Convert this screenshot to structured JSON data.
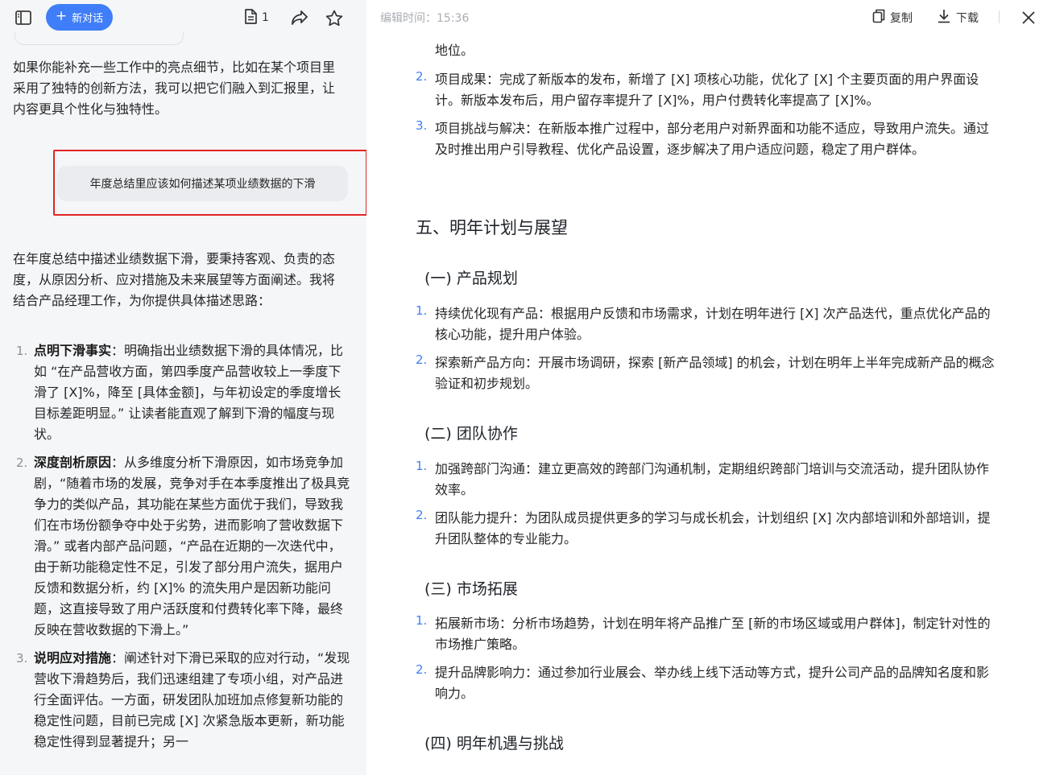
{
  "left_toolbar": {
    "sidebar_icon": "sidebar-toggle-icon",
    "new_chat_label": "新对话",
    "doc_count": "1",
    "share_icon": "share-icon",
    "star_icon": "star-icon"
  },
  "chat": {
    "prev_ai_text": "如果你能补充一些工作中的亮点细节，比如在某个项目里采用了独特的创新方法，我可以把它们融入到汇报里，让内容更具个性化与独特性。",
    "user_question": "年度总结里应该如何描述某项业绩数据的下滑",
    "answer_intro": "在年度总结中描述业绩数据下滑，要秉持客观、负责的态度，从原因分析、应对措施及未来展望等方面阐述。我将结合产品经理工作，为你提供具体描述思路：",
    "answer_items": [
      {
        "num": "1.",
        "title": "点明下滑事实",
        "text": "：明确指出业绩数据下滑的具体情况，比如 “在产品营收方面，第四季度产品营收较上一季度下滑了 [X]%，降至 [具体金额]，与年初设定的季度增长目标差距明显。” 让读者能直观了解到下滑的幅度与现状。"
      },
      {
        "num": "2.",
        "title": "深度剖析原因",
        "text": "：从多维度分析下滑原因，如市场竞争加剧，“随着市场的发展，竞争对手在本季度推出了极具竞争力的类似产品，其功能在某些方面优于我们，导致我们在市场份额争夺中处于劣势，进而影响了营收数据下滑。” 或者内部产品问题，“产品在近期的一次迭代中，由于新功能稳定性不足，引发了部分用户流失，据用户反馈和数据分析，约 [X]% 的流失用户是因新功能问题，这直接导致了用户活跃度和付费转化率下降，最终反映在营收数据的下滑上。”"
      },
      {
        "num": "3.",
        "title": "说明应对措施",
        "text": "：阐述针对下滑已采取的应对行动，“发现营收下滑趋势后，我们迅速组建了专项小组，对产品进行全面评估。一方面，研发团队加班加点修复新功能的稳定性问题，目前已完成 [X] 次紧急版本更新，新功能稳定性得到显著提升；另一"
      }
    ]
  },
  "doc_header": {
    "edit_time": "编辑时间：15:36",
    "copy_label": "复制",
    "download_label": "下载"
  },
  "doc": {
    "top_fragment": "地位。",
    "prev_items": [
      {
        "num": "2.",
        "text": "项目成果：完成了新版本的发布，新增了 [X] 项核心功能，优化了 [X] 个主要页面的用户界面设计。新版本发布后，用户留存率提升了 [X]%，用户付费转化率提高了 [X]%。"
      },
      {
        "num": "3.",
        "text": "项目挑战与解决：在新版本推广过程中，部分老用户对新界面和功能不适应，导致用户流失。通过及时推出用户引导教程、优化产品设置，逐步解决了用户适应问题，稳定了用户群体。"
      }
    ],
    "section_title": "五、明年计划与展望",
    "subsections": [
      {
        "title": "(一) 产品规划",
        "items": [
          {
            "num": "1.",
            "text": "持续优化现有产品：根据用户反馈和市场需求，计划在明年进行 [X] 次产品迭代，重点优化产品的核心功能，提升用户体验。"
          },
          {
            "num": "2.",
            "text": "探索新产品方向：开展市场调研，探索 [新产品领域] 的机会，计划在明年上半年完成新产品的概念验证和初步规划。"
          }
        ]
      },
      {
        "title": "(二) 团队协作",
        "items": [
          {
            "num": "1.",
            "text": "加强跨部门沟通：建立更高效的跨部门沟通机制，定期组织跨部门培训与交流活动，提升团队协作效率。"
          },
          {
            "num": "2.",
            "text": "团队能力提升：为团队成员提供更多的学习与成长机会，计划组织 [X] 次内部培训和外部培训，提升团队整体的专业能力。"
          }
        ]
      },
      {
        "title": "(三) 市场拓展",
        "items": [
          {
            "num": "1.",
            "text": "拓展新市场：分析市场趋势，计划在明年将产品推广至 [新的市场区域或用户群体]，制定针对性的市场推广策略。"
          },
          {
            "num": "2.",
            "text": "提升品牌影响力：通过参加行业展会、举办线上线下活动等方式，提升公司产品的品牌知名度和影响力。"
          }
        ]
      },
      {
        "title": "(四) 明年机遇与挑战",
        "items": []
      }
    ]
  },
  "colors": {
    "accent": "#3f7ef8",
    "highlight_box": "#e32424",
    "left_bg": "#f5f6f8"
  }
}
